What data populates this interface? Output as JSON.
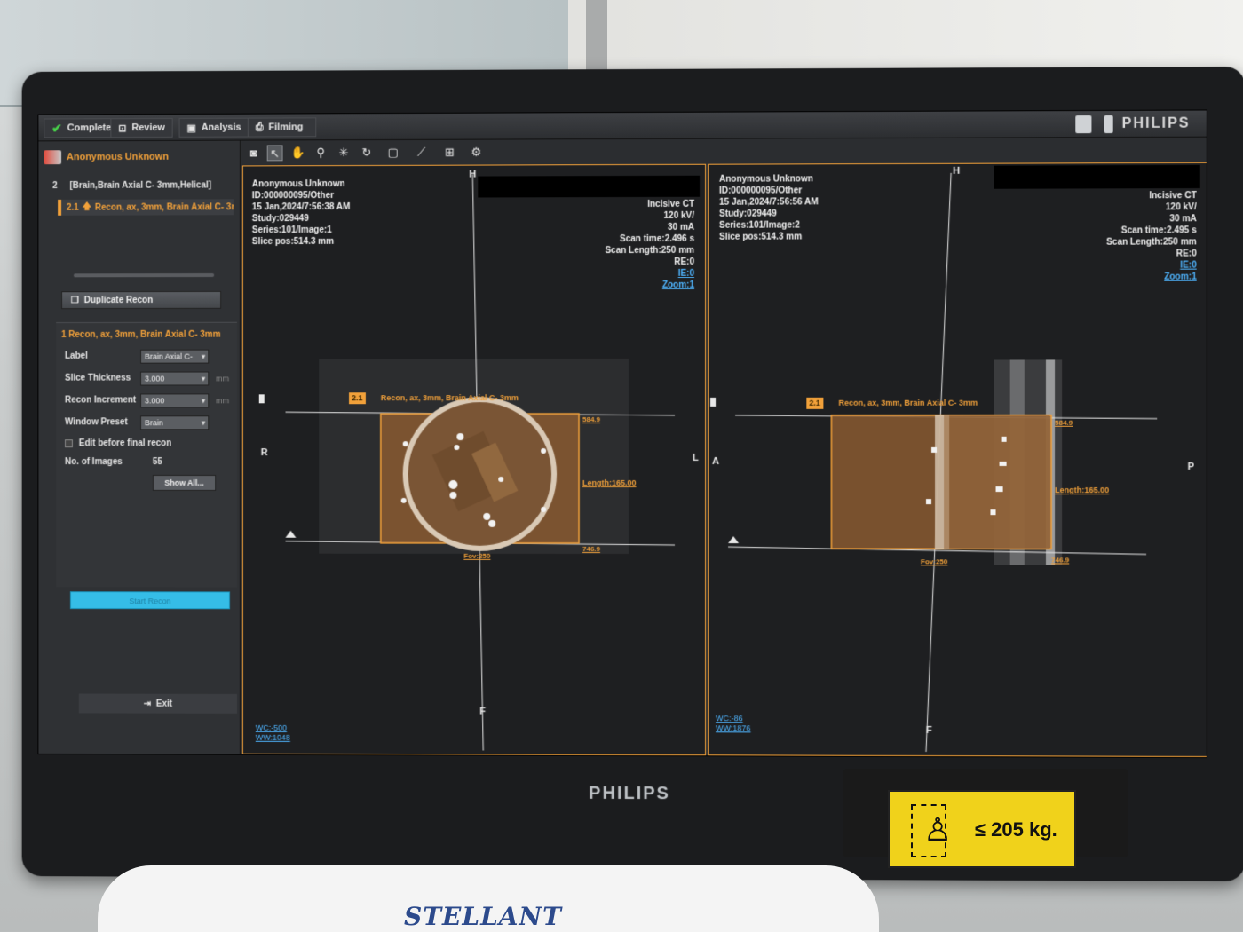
{
  "tabs": [
    {
      "label": "Completed",
      "icon": "check-icon"
    },
    {
      "label": "Review",
      "icon": "review-icon"
    },
    {
      "label": "Analysis",
      "icon": "analysis-icon"
    },
    {
      "label": "Filming",
      "icon": "printer-icon"
    }
  ],
  "brand": "PHILIPS",
  "bezel_brand": "PHILIPS",
  "base_brand": "STELLANT",
  "sticker_text": "≤ 205 kg.",
  "left": {
    "patient": "Anonymous Unknown",
    "series_num": "2",
    "series_desc": "[Brain,Brain Axial C- 3mm,Helical]",
    "recon_id": "2.1",
    "recon_item": "Recon, ax, 3mm, Brain Axial C- 3r",
    "duplicate": "Duplicate Recon",
    "recon_title": "1 Recon, ax, 3mm, Brain Axial C- 3mm",
    "fields": {
      "label_name": "Label",
      "label_value": "Brain Axial C-",
      "slice_name": "Slice Thickness",
      "slice_value": "3.000",
      "slice_unit": "mm",
      "incr_name": "Recon Increment",
      "incr_value": "3.000",
      "incr_unit": "mm",
      "window_name": "Window Preset",
      "window_value": "Brain",
      "edit_final": "Edit before final recon",
      "images_name": "No. of Images",
      "images_value": "55"
    },
    "show_all": "Show All...",
    "start_recon": "Start Recon",
    "exit": "Exit"
  },
  "vp1": {
    "tl": [
      "Anonymous Unknown",
      "ID:000000095/Other",
      "15 Jan,2024/7:56:38 AM",
      "Study:029449",
      "Series:101/Image:1",
      "Slice pos:514.3 mm"
    ],
    "tr": [
      "Incisive CT",
      "120 kV/",
      "30 mA",
      "Scan time:2.496 s",
      "Scan Length:250 mm",
      "RE:0"
    ],
    "links": [
      "IE:0",
      "Zoom:1"
    ],
    "orient": {
      "top": "H",
      "bottom": "F",
      "left": "R",
      "right": "L"
    },
    "box_tag": "2.1",
    "box_label": "Recon, ax, 3mm, Brain Axial C- 3mm",
    "top_val": "584.9",
    "length": "Length:165.00",
    "bottom_val": "746.9",
    "fov": "Fov:250",
    "wc": "WC:-500",
    "ww": "WW:1048"
  },
  "vp2": {
    "tl": [
      "Anonymous Unknown",
      "ID:000000095/Other",
      "15 Jan,2024/7:56:56 AM",
      "Study:029449",
      "Series:101/Image:2",
      "Slice pos:514.3 mm"
    ],
    "tr": [
      "Incisive CT",
      "120 kV/",
      "30 mA",
      "Scan time:2.495 s",
      "Scan Length:250 mm",
      "RE:0"
    ],
    "links": [
      "IE:0",
      "Zoom:1"
    ],
    "orient": {
      "top": "H",
      "bottom": "F",
      "left": "A",
      "right": "P"
    },
    "box_tag": "2.1",
    "box_label": "Recon, ax, 3mm, Brain Axial C- 3mm",
    "top_val": "584.9",
    "length": "Length:165.00",
    "bottom_val": "746.9",
    "fov": "Fov:250",
    "wc": "WC:-86",
    "ww": "WW:1876"
  },
  "colors": {
    "accent": "#f2a13a",
    "link": "#4fb5ff",
    "start": "#35bde7",
    "box_fill": "#8a5a30"
  }
}
